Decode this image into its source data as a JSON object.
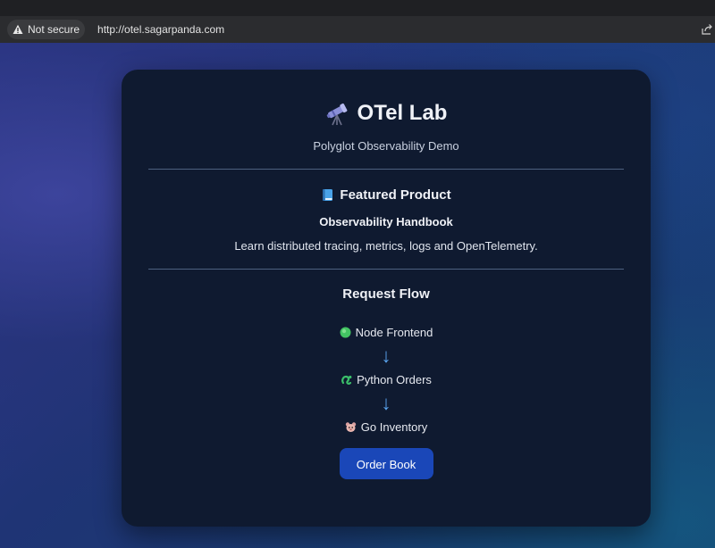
{
  "browser": {
    "security_label": "Not secure",
    "url": "http://otel.sagarpanda.com"
  },
  "app": {
    "title": "OTel Lab",
    "title_icon": "telescope-icon",
    "subtitle": "Polyglot Observability Demo"
  },
  "featured": {
    "heading": "Featured Product",
    "heading_icon": "book-icon",
    "product_name": "Observability Handbook",
    "description": "Learn distributed tracing, metrics, logs and OpenTelemetry."
  },
  "flow": {
    "heading": "Request Flow",
    "steps": [
      {
        "label": "Node Frontend",
        "icon": "green-circle-icon"
      },
      {
        "label": "Python Orders",
        "icon": "snake-icon"
      },
      {
        "label": "Go Inventory",
        "icon": "gopher-icon"
      }
    ],
    "arrow": "↓"
  },
  "actions": {
    "order_label": "Order Book"
  },
  "colors": {
    "card_bg": "#0f1a30",
    "accent_button": "#1a47b8",
    "arrow": "#5aa5f0"
  }
}
